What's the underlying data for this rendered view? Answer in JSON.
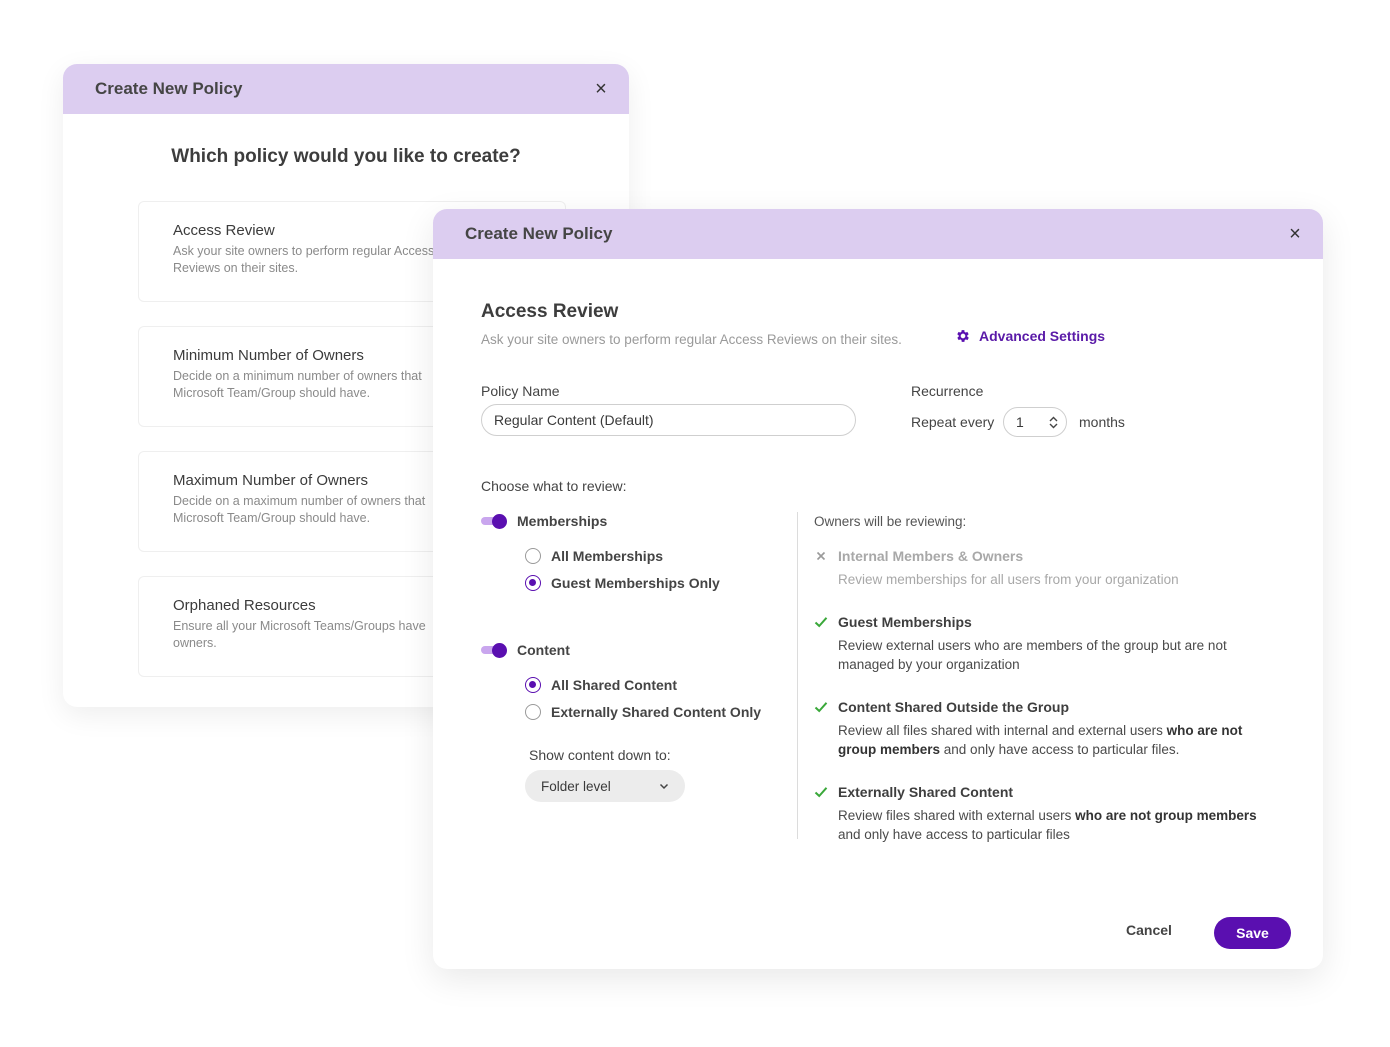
{
  "back_dialog": {
    "title": "Create New Policy",
    "question": "Which policy would you like to create?",
    "options": [
      {
        "title": "Access Review",
        "desc": "Ask your site owners to perform regular Access Reviews on their sites."
      },
      {
        "title": "Minimum Number of Owners",
        "desc": "Decide on a minimum number of owners that Microsoft Team/Group should have."
      },
      {
        "title": "Maximum Number of Owners",
        "desc": "Decide on a maximum number of owners that Microsoft Team/Group should have."
      },
      {
        "title": "Orphaned Resources",
        "desc": "Ensure all your Microsoft Teams/Groups have owners."
      }
    ]
  },
  "front_dialog": {
    "title": "Create New Policy",
    "section_title": "Access Review",
    "section_desc": "Ask your site owners to perform regular Access Reviews on their sites.",
    "advanced_settings": "Advanced Settings",
    "policy_name_label": "Policy Name",
    "policy_name_value": "Regular Content (Default)",
    "recurrence_label": "Recurrence",
    "repeat_every": "Repeat every",
    "repeat_value": "1",
    "repeat_unit": "months",
    "choose_label": "Choose what to review:",
    "memberships": {
      "label": "Memberships",
      "enabled": true,
      "options": [
        "All Memberships",
        "Guest Memberships Only"
      ],
      "selected": "Guest Memberships Only"
    },
    "content": {
      "label": "Content",
      "enabled": true,
      "options": [
        "All Shared Content",
        "Externally Shared Content Only"
      ],
      "selected": "All Shared Content",
      "show_down_label": "Show content down to:",
      "show_down_value": "Folder level"
    },
    "review_head": "Owners will be reviewing:",
    "review_items": [
      {
        "status": "excluded",
        "title": "Internal Members & Owners",
        "body": "Review memberships for all users from your organization"
      },
      {
        "status": "included",
        "title": "Guest Memberships",
        "body": "Review external users who are members of the group but are not managed by your organization"
      },
      {
        "status": "included",
        "title": "Content Shared Outside the Group",
        "body_pre": "Review all files shared with internal and external users ",
        "body_bold": "who are not group members",
        "body_post": " and only have access to particular files."
      },
      {
        "status": "included",
        "title": "Externally Shared Content",
        "body_pre": "Review files shared with external users ",
        "body_bold": "who are not group members",
        "body_post": " and only have access to particular files"
      }
    ],
    "cancel": "Cancel",
    "save": "Save",
    "colors": {
      "accent": "#5a0fb0",
      "header_bg": "#dccdf0",
      "check": "#3aa83a"
    }
  }
}
